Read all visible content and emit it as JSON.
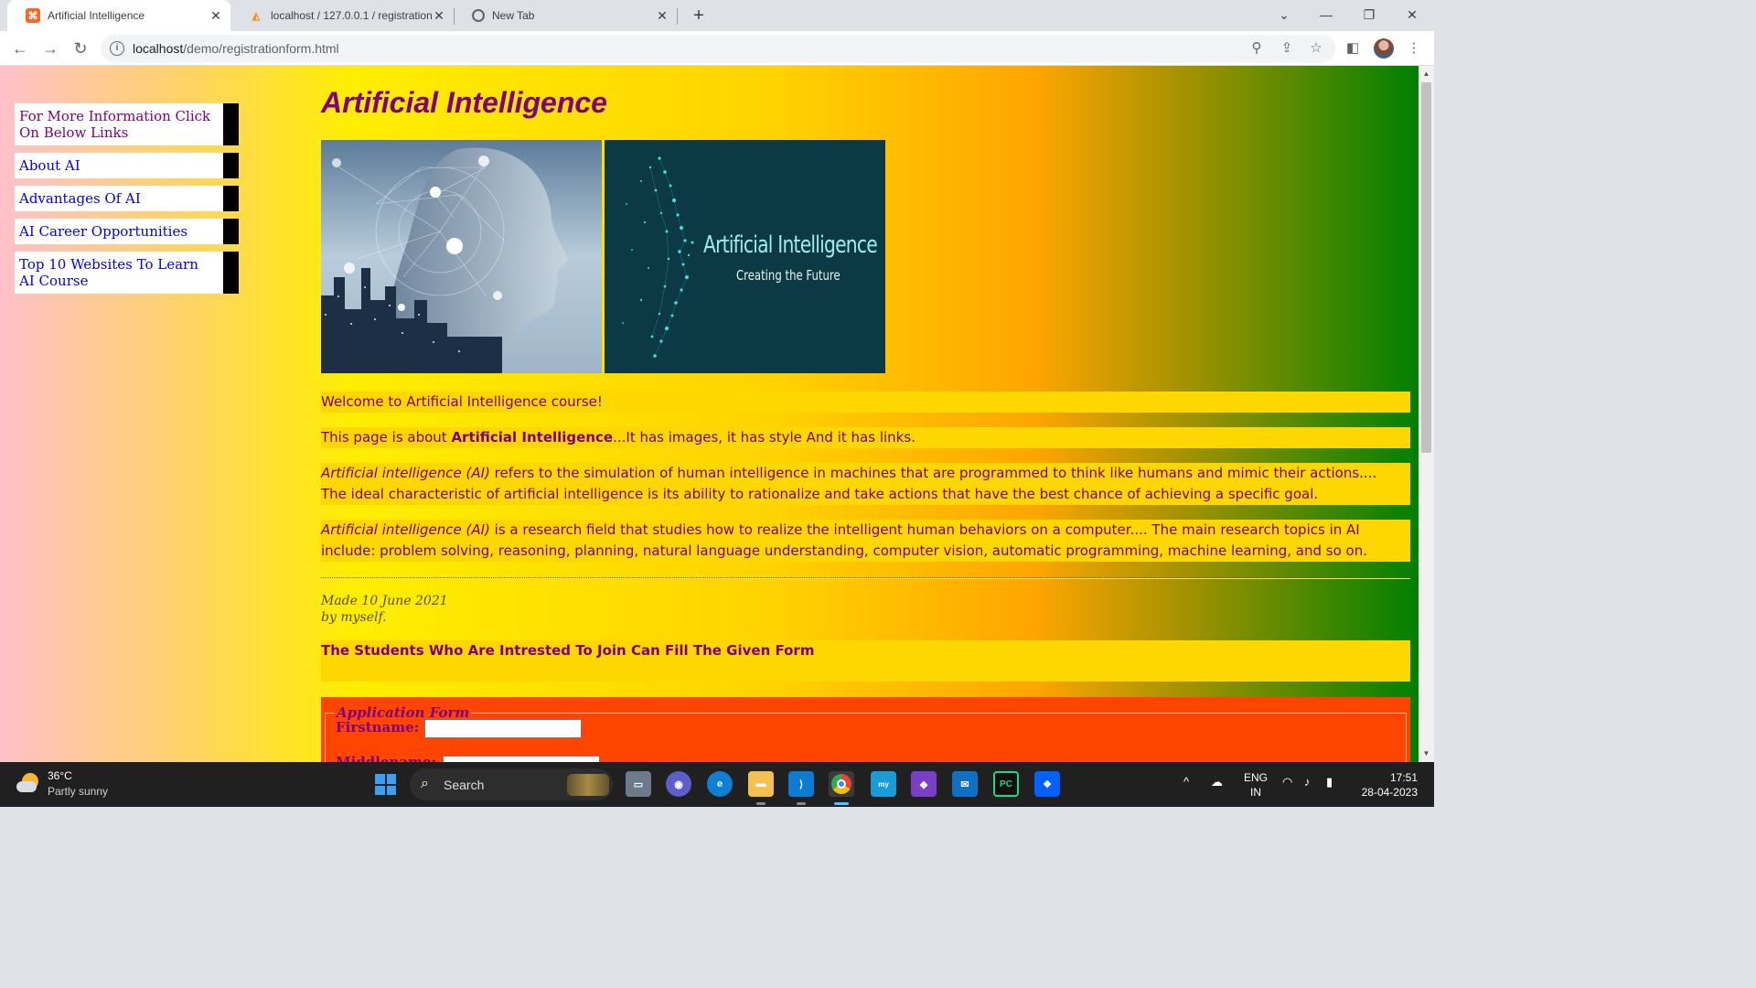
{
  "browser": {
    "tabs": [
      {
        "title": "Artificial Intelligence",
        "active": true
      },
      {
        "title": "localhost / 127.0.0.1 / registration",
        "active": false
      },
      {
        "title": "New Tab",
        "active": false
      }
    ],
    "url_host": "localhost",
    "url_path": "/demo/registrationform.html"
  },
  "sidebar": {
    "items": [
      {
        "label": "For More Information Click On Below Links"
      },
      {
        "label": "About AI"
      },
      {
        "label": "Advantages Of AI"
      },
      {
        "label": "AI Career Opportunities"
      },
      {
        "label": "Top 10 Websites To Learn AI Course"
      }
    ]
  },
  "page": {
    "title": "Artificial Intelligence",
    "image2_title": "Artificial Intelligence",
    "image2_subtitle": "Creating the Future",
    "welcome": "Welcome to Artificial Intelligence course!",
    "intro_before": "This page is about ",
    "intro_bold": "Artificial Intelligence",
    "intro_after": "...It has images, it has style And it has links.",
    "para1_em": "Artificial intelligence (AI)",
    "para1_rest": " refers to the simulation of human intelligence in machines that are programmed to think like humans and mimic their actions.... The ideal characteristic of artificial intelligence is its ability to rationalize and take actions that have the best chance of achieving a specific goal.",
    "para2_em": "Artificial intelligence (AI)",
    "para2_rest": " is a research field that studies how to realize the intelligent human behaviors on a computer.... The main research topics in AI include: problem solving, reasoning, planning, natural language understanding, computer vision, automatic programming, machine learning, and so on.",
    "made_line1": "Made 10 June 2021",
    "made_line2": "by myself.",
    "form_heading": "The Students Who Are Intrested To Join Can Fill The Given Form"
  },
  "form": {
    "legend": "Application Form",
    "firstname_label": "Firstname:",
    "firstname_value": "",
    "middlename_label": "Middlename:",
    "middlename_value": ""
  },
  "taskbar": {
    "temperature": "36°C",
    "weather": "Partly sunny",
    "search_label": "Search",
    "lang_line1": "ENG",
    "lang_line2": "IN",
    "time": "17:51",
    "date": "28-04-2023"
  },
  "colors": {
    "heading": "#800080",
    "link": "#0000ee",
    "para_bg": "#ffd700",
    "form_bg": "#ff4500"
  }
}
